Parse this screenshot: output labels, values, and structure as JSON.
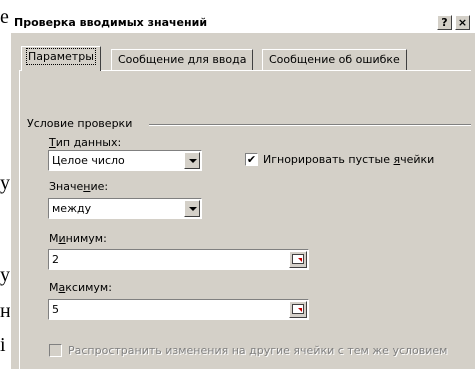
{
  "background_letters": [
    "е",
    "у",
    "у",
    "н",
    "і"
  ],
  "dialog": {
    "title": "Проверка вводимых значений",
    "help_button": "?",
    "close_button": "×"
  },
  "tabs": [
    {
      "label": "Параметры",
      "active": true
    },
    {
      "label": "Сообщение для ввода",
      "active": false
    },
    {
      "label": "Сообщение об ошибке",
      "active": false
    }
  ],
  "validation": {
    "group_label": "Условие проверки",
    "data_type": {
      "label_hotkey": "Т",
      "label_rest": "ип данных:",
      "value": "Целое число"
    },
    "ignore_blank": {
      "label_before": "Игнорировать пустые ",
      "label_hotkey": "я",
      "label_after": "чейки",
      "checked": true,
      "mark": "✔"
    },
    "operator": {
      "label_before": "Значе",
      "label_hotkey": "н",
      "label_after": "ие:",
      "value": "между"
    },
    "minimum": {
      "label_before": "М",
      "label_hotkey": "и",
      "label_after": "нимум:",
      "value": "2"
    },
    "maximum": {
      "label_before": "М",
      "label_hotkey": "а",
      "label_after": "ксимум:",
      "value": "5"
    },
    "apply_to_all": {
      "label": "Распространить изменения на другие ячейки с тем же условием",
      "checked": false,
      "enabled": false
    }
  },
  "icons": {
    "dropdown": "chevron-down-icon",
    "range_picker": "collapse-dialog-icon"
  },
  "colors": {
    "dialog_face": "#d4d0c8",
    "field_bg": "#ffffff",
    "disabled_text": "#808080"
  }
}
